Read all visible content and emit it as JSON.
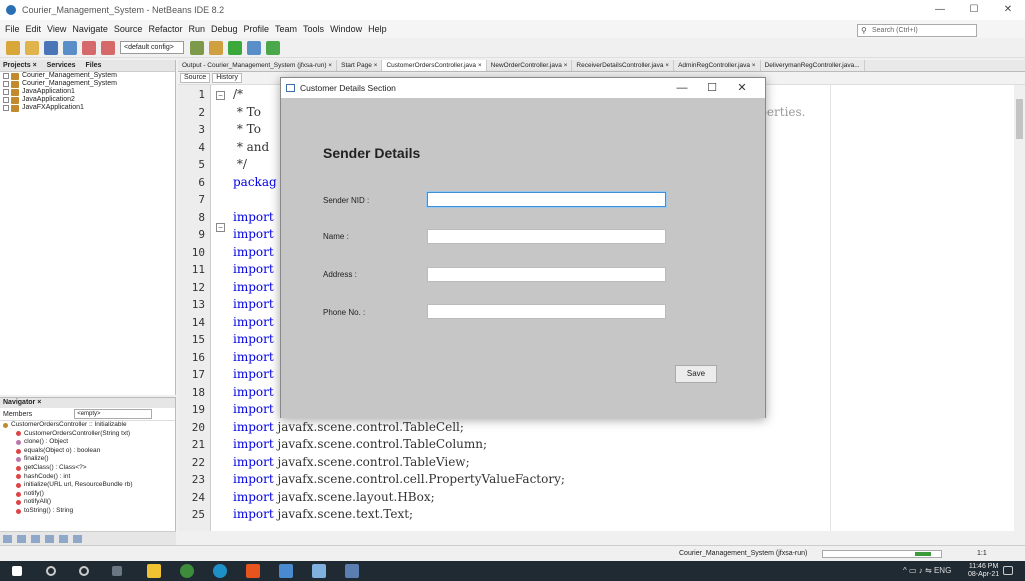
{
  "window": {
    "title": "Courier_Management_System - NetBeans IDE 8.2"
  },
  "menu": [
    "File",
    "Edit",
    "View",
    "Navigate",
    "Source",
    "Refactor",
    "Run",
    "Debug",
    "Profile",
    "Team",
    "Tools",
    "Window",
    "Help"
  ],
  "search": {
    "placeholder": "Search (Ctrl+I)"
  },
  "toolbar": {
    "config": "<default config>"
  },
  "projects": {
    "tabs": [
      "Projects ×",
      "Services",
      "Files"
    ],
    "items": [
      "Courier_Management_System",
      "Courier_Management_System",
      "JavaApplication1",
      "JavaApplication2",
      "JavaFXApplication1"
    ]
  },
  "navigator": {
    "title": "Navigator ×",
    "members_label": "Members",
    "members_select": "<empty>",
    "root": "CustomerOrdersController :: Initializable",
    "items": [
      "CustomerOrdersController(String txt)",
      "clone() : Object",
      "equals(Object o) : boolean",
      "finalize()",
      "getClass() : Class<?>",
      "hashCode() : int",
      "initialize(URL url, ResourceBundle rb)",
      "notify()",
      "notifyAll()",
      "toString() : String"
    ]
  },
  "tabs": [
    "Output - Courier_Management_System (jfxsa-run) ×",
    "Start Page ×",
    "CustomerOrdersController.java ×",
    "NewOrderController.java ×",
    "ReceiverDetailsController.java ×",
    "AdminRegController.java ×",
    "DeliverymanRegController.java..."
  ],
  "editor": {
    "source_tab": "Source",
    "history_tab": "History",
    "line_numbers": [
      "1",
      "2",
      "3",
      "4",
      "5",
      "6",
      "7",
      "8",
      "9",
      "10",
      "11",
      "12",
      "13",
      "14",
      "15",
      "16",
      "17",
      "18",
      "19",
      "20",
      "21",
      "22",
      "23",
      "24",
      "25"
    ],
    "lines": [
      "/*",
      " * To",
      " * To",
      " * and",
      " */",
      "packag",
      "",
      "import",
      "import",
      "import",
      "import",
      "import",
      "import",
      "import",
      "import",
      "import",
      "import",
      "import",
      "import",
      "import javafx.scene.control.TableCell;",
      "import javafx.scene.control.TableColumn;",
      "import javafx.scene.control.TableView;",
      "import javafx.scene.control.cell.PropertyValueFactory;",
      "import javafx.scene.layout.HBox;",
      "import javafx.scene.text.Text;"
    ],
    "partial_right": "operties."
  },
  "status": {
    "project": "Courier_Management_System (jfxsa-run)",
    "position": "1:1"
  },
  "taskbar": {
    "lang": "ENG",
    "time": "11:46 PM",
    "date": "08-Apr-21"
  },
  "dialog": {
    "title": "Customer Details Section",
    "heading": "Sender Details",
    "fields": [
      {
        "label": "Sender NID :",
        "value": ""
      },
      {
        "label": "Name :",
        "value": ""
      },
      {
        "label": "Address :",
        "value": ""
      },
      {
        "label": "Phone No. :",
        "value": ""
      }
    ],
    "save": "Save"
  }
}
